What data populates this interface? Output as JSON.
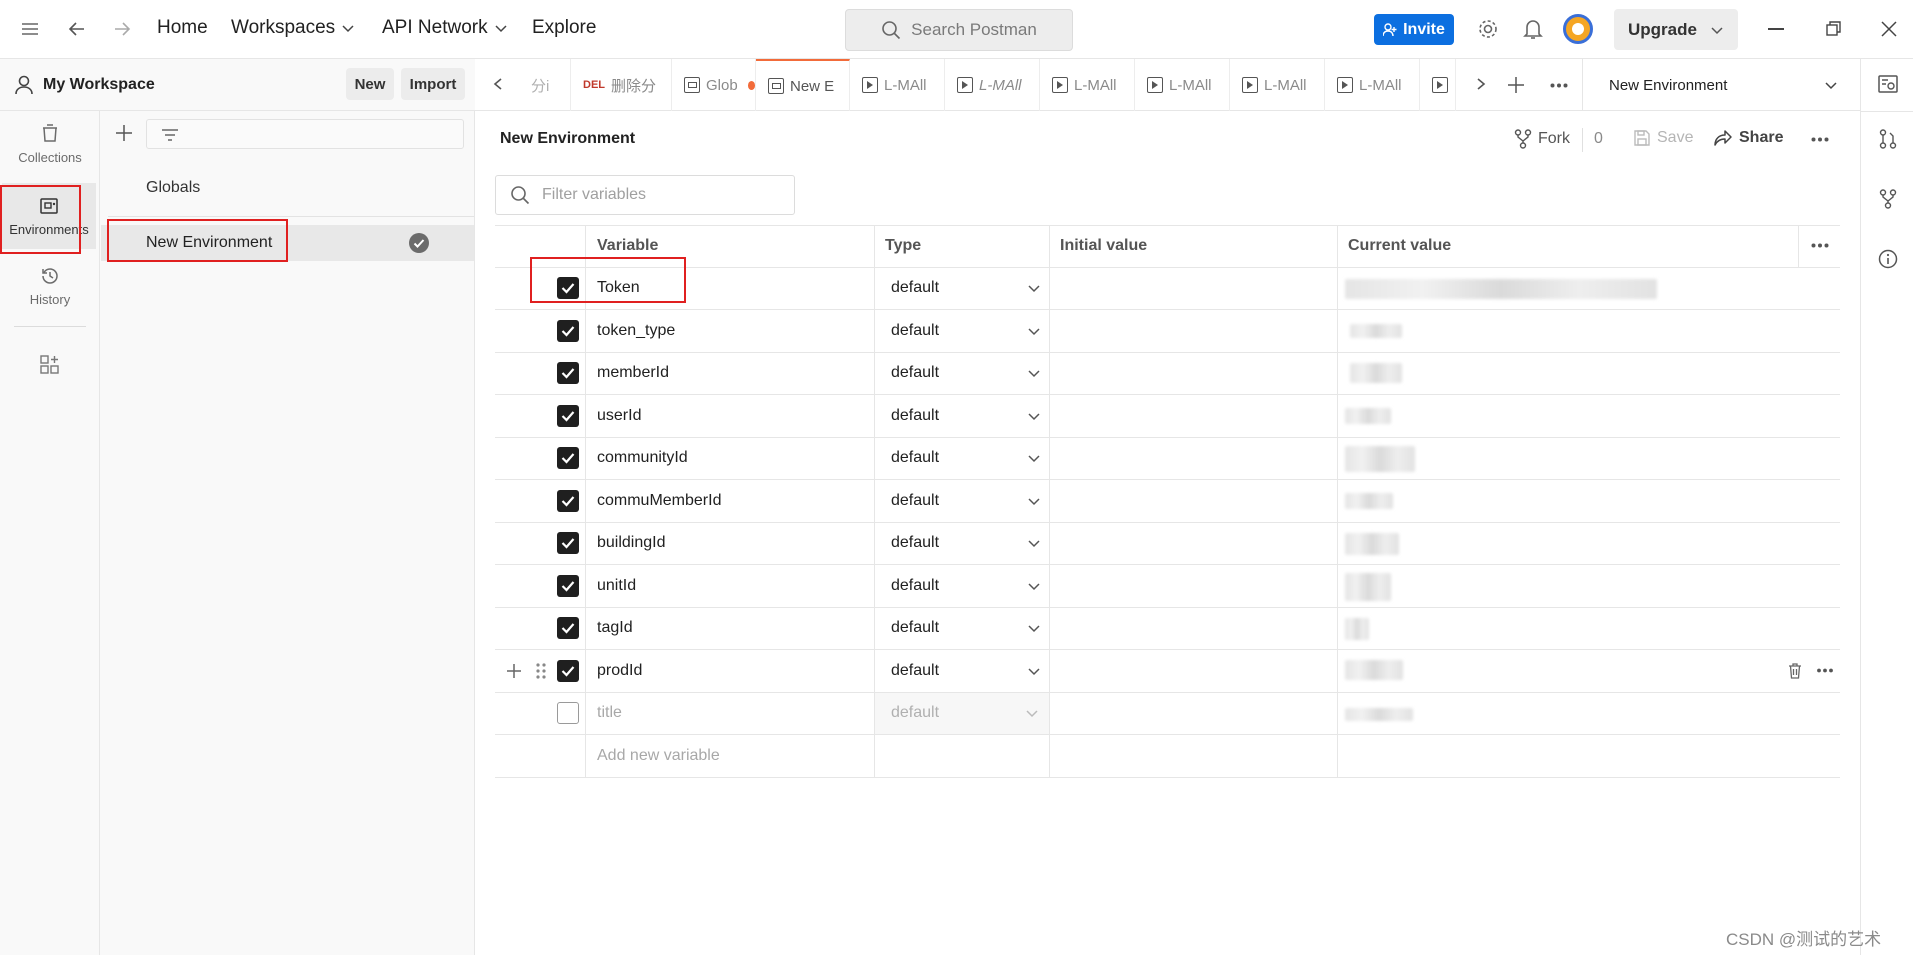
{
  "topbar": {
    "home": "Home",
    "workspaces": "Workspaces",
    "api_network": "API Network",
    "explore": "Explore",
    "search_placeholder": "Search Postman",
    "invite": "Invite",
    "upgrade": "Upgrade"
  },
  "sidebar": {
    "workspace_name": "My Workspace",
    "new_label": "New",
    "import_label": "Import",
    "rail": [
      {
        "label": "Collections",
        "icon": "collections-icon"
      },
      {
        "label": "Environments",
        "icon": "environments-icon"
      },
      {
        "label": "History",
        "icon": "history-icon"
      }
    ],
    "items": [
      {
        "label": "Globals"
      },
      {
        "label": "New Environment"
      }
    ]
  },
  "tabs": {
    "items": [
      {
        "label": "分i",
        "method": ""
      },
      {
        "label": "删除分",
        "method": "DEL"
      },
      {
        "label": "Glob",
        "method": ""
      },
      {
        "label": "New E",
        "method": ""
      },
      {
        "label": "L-MAll",
        "method": ""
      },
      {
        "label": "L-MAll",
        "method": ""
      },
      {
        "label": "L-MAll",
        "method": ""
      },
      {
        "label": "L-MAll",
        "method": ""
      },
      {
        "label": "L-MAll",
        "method": ""
      },
      {
        "label": "L-MAll",
        "method": ""
      }
    ],
    "env_selector": "New Environment"
  },
  "editor": {
    "title": "New Environment",
    "fork_label": "Fork",
    "fork_count": "0",
    "save_label": "Save",
    "share_label": "Share",
    "filter_placeholder": "Filter variables",
    "columns": [
      "Variable",
      "Type",
      "Initial value",
      "Current value"
    ],
    "variables": [
      {
        "name": "Token",
        "type": "default",
        "enabled": true
      },
      {
        "name": "token_type",
        "type": "default",
        "enabled": true
      },
      {
        "name": "memberId",
        "type": "default",
        "enabled": true
      },
      {
        "name": "userId",
        "type": "default",
        "enabled": true
      },
      {
        "name": "communityId",
        "type": "default",
        "enabled": true
      },
      {
        "name": "commuMemberId",
        "type": "default",
        "enabled": true
      },
      {
        "name": "buildingId",
        "type": "default",
        "enabled": true
      },
      {
        "name": "unitId",
        "type": "default",
        "enabled": true
      },
      {
        "name": "tagId",
        "type": "default",
        "enabled": true
      },
      {
        "name": "prodId",
        "type": "default",
        "enabled": true
      },
      {
        "name": "title",
        "type": "default",
        "enabled": false
      }
    ],
    "add_new": "Add new variable"
  },
  "watermark": "CSDN @测试的艺术"
}
